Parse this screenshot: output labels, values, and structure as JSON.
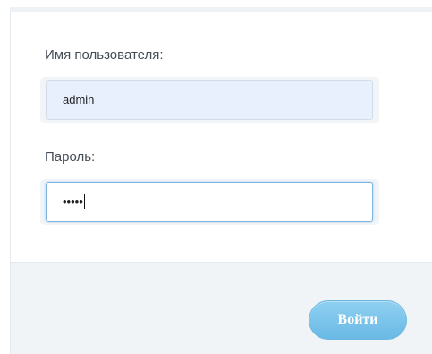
{
  "form": {
    "username_label": "Имя пользователя:",
    "username_value": "admin",
    "password_label": "Пароль:",
    "password_value": "•••••"
  },
  "footer": {
    "login_label": "Войти"
  },
  "colors": {
    "accent": "#6ab9e6",
    "footer_bg": "#f1f4f7",
    "autofill_bg": "#e8f0fe"
  }
}
